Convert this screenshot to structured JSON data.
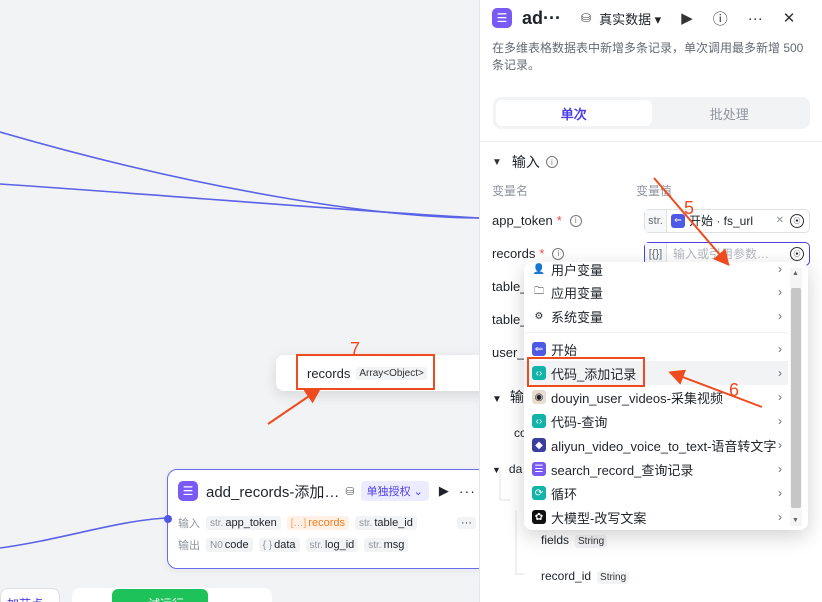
{
  "node": {
    "title": "add_records-添加…",
    "auth_badge": "单独授权 ⌄",
    "input_label": "输入",
    "output_label": "输出",
    "inputs": [
      {
        "type": "str.",
        "name": "app_token"
      },
      {
        "type": "[…]",
        "name": "records"
      },
      {
        "type": "str.",
        "name": "table_id"
      }
    ],
    "outputs": [
      {
        "type": "N0",
        "name": "code"
      },
      {
        "type": "{ }",
        "name": "data"
      },
      {
        "type": "str.",
        "name": "log_id"
      },
      {
        "type": "str.",
        "name": "msg"
      }
    ],
    "more": "···"
  },
  "bottom": {
    "add_node": "加节点",
    "trial_run": "试运行"
  },
  "popup": {
    "name": "records",
    "type": "Array<Object>"
  },
  "panel": {
    "title": "ad···",
    "data_mode": "真实数据 ▾",
    "description": "在多维表格数据表中新增多条记录，单次调用最多新增 500 条记录。",
    "tabs": [
      "单次",
      "批处理"
    ],
    "input_section": "输入",
    "col_name": "变量名",
    "col_value": "变量值",
    "params": [
      {
        "name": "app_token",
        "required": "*"
      },
      {
        "name": "records",
        "required": "*"
      },
      {
        "name": "table_",
        "required": ""
      },
      {
        "name": "table_",
        "required": ""
      },
      {
        "name": "user_",
        "required": ""
      }
    ],
    "app_token_type": "str.",
    "app_token_ref": "开始 · fs_url",
    "records_type": "[{}]",
    "records_placeholder": "输入或引用参数…",
    "output_section": "输",
    "out_rows": [
      {
        "name": "co",
        "type": ""
      },
      {
        "name": "da",
        "type": ""
      },
      {
        "name": "fields",
        "type": "String"
      },
      {
        "name": "record_id",
        "type": "String"
      }
    ]
  },
  "menu": {
    "items": [
      {
        "label": "用户变量",
        "icon": "user-icon"
      },
      {
        "label": "应用变量",
        "icon": "folder-icon"
      },
      {
        "label": "系统变量",
        "icon": "gear-icon"
      },
      {
        "label": "开始",
        "icon": "start-icon"
      },
      {
        "label": "代码_添加记录",
        "icon": "code-icon"
      },
      {
        "label": "douyin_user_videos-采集视频",
        "icon": "plugin-icon"
      },
      {
        "label": "代码-查询",
        "icon": "code-icon"
      },
      {
        "label": "aliyun_video_voice_to_text-语音转文字",
        "icon": "plugin-icon"
      },
      {
        "label": "search_record_查询记录",
        "icon": "table-icon"
      },
      {
        "label": "循环",
        "icon": "loop-icon"
      },
      {
        "label": "大模型-改写文案",
        "icon": "llm-icon"
      }
    ]
  },
  "annotations": [
    "5",
    "6",
    "7"
  ],
  "colors": {
    "accent": "#4e40e5",
    "annotation": "#ee4b1e",
    "wire": "#4e5ae6"
  }
}
